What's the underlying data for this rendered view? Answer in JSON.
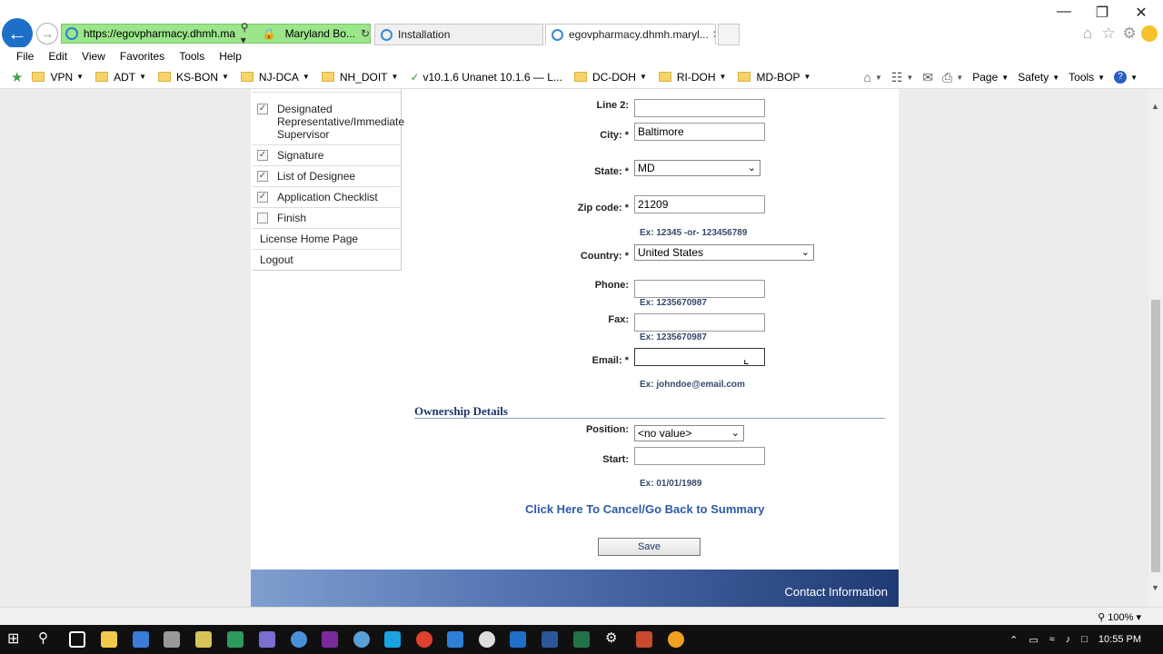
{
  "browser": {
    "address_url": "https://egovpharmacy.dhmh.ma...",
    "site_identity": "Maryland Bo...",
    "tabs": [
      {
        "label": "Installation"
      },
      {
        "label": "egovpharmacy.dhmh.maryl..."
      }
    ],
    "menu": [
      "File",
      "Edit",
      "View",
      "Favorites",
      "Tools",
      "Help"
    ],
    "favorites": [
      "VPN",
      "ADT",
      "KS-BON",
      "NJ-DCA",
      "NH_DOIT",
      "v10.1.6 Unanet 10.1.6 — L...",
      "DC-DOH",
      "RI-DOH",
      "MD-BOP"
    ],
    "command_bar": {
      "page": "Page",
      "safety": "Safety",
      "tools": "Tools"
    },
    "zoom": "100%"
  },
  "sidebar": {
    "items": [
      {
        "label": "Designated Representative/Immediate Supervisor",
        "checked": true
      },
      {
        "label": "Signature",
        "checked": true
      },
      {
        "label": "List of Designee",
        "checked": true
      },
      {
        "label": "Application Checklist",
        "checked": true
      },
      {
        "label": "Finish",
        "checked": false
      }
    ],
    "links": [
      "License Home Page",
      "Logout"
    ]
  },
  "form": {
    "line2": {
      "label": "Line 2:",
      "value": ""
    },
    "city": {
      "label": "City: *",
      "value": "Baltimore"
    },
    "state": {
      "label": "State: *",
      "value": "MD"
    },
    "zip": {
      "label": "Zip code: *",
      "value": "21209",
      "hint": "Ex: 12345 -or- 123456789"
    },
    "country": {
      "label": "Country: *",
      "value": "United States"
    },
    "phone": {
      "label": "Phone:",
      "value": "",
      "hint": "Ex: 1235670987"
    },
    "fax": {
      "label": "Fax:",
      "value": "",
      "hint": "Ex: 1235670987"
    },
    "email": {
      "label": "Email: *",
      "value": "",
      "hint": "Ex: johndoe@email.com"
    },
    "ownership_title": "Ownership Details",
    "position": {
      "label": "Position:",
      "value": "<no value>"
    },
    "start": {
      "label": "Start:",
      "value": "",
      "hint": "Ex: 01/01/1989"
    },
    "cancel_link": "Click Here To Cancel/Go Back to Summary",
    "save_label": "Save"
  },
  "footer": {
    "text": "Contact Information"
  },
  "taskbar": {
    "clock": "10:55 PM"
  }
}
